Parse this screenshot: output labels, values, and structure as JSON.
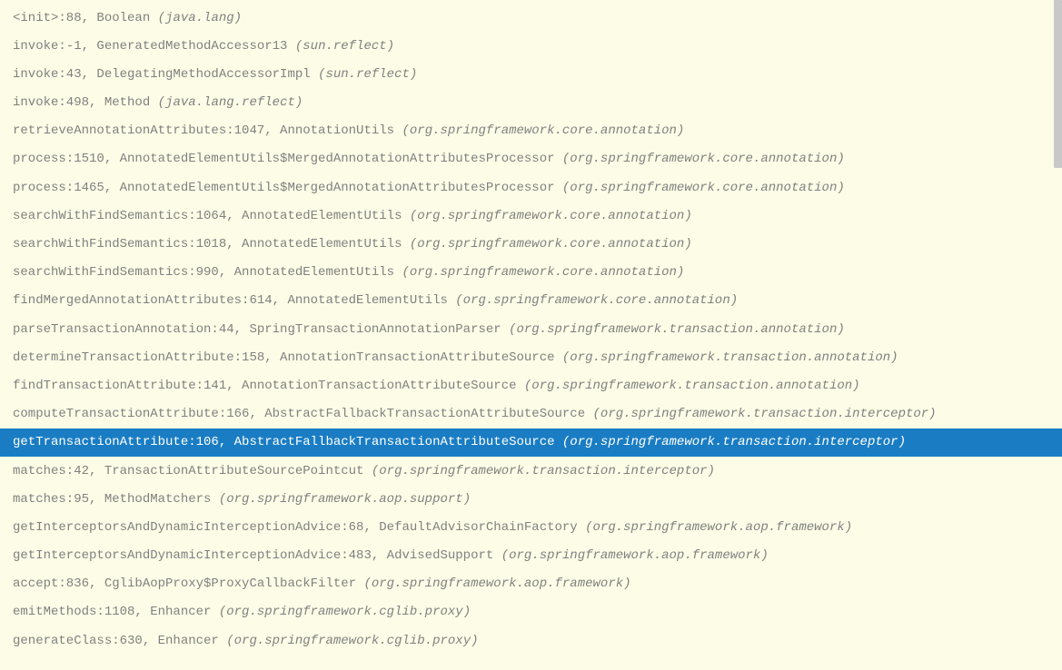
{
  "selectedIndex": 15,
  "frames": [
    {
      "method": "<init>",
      "line": "88",
      "class": "Boolean",
      "package": "(java.lang)"
    },
    {
      "method": "invoke",
      "line": "-1",
      "class": "GeneratedMethodAccessor13",
      "package": "(sun.reflect)"
    },
    {
      "method": "invoke",
      "line": "43",
      "class": "DelegatingMethodAccessorImpl",
      "package": "(sun.reflect)"
    },
    {
      "method": "invoke",
      "line": "498",
      "class": "Method",
      "package": "(java.lang.reflect)"
    },
    {
      "method": "retrieveAnnotationAttributes",
      "line": "1047",
      "class": "AnnotationUtils",
      "package": "(org.springframework.core.annotation)"
    },
    {
      "method": "process",
      "line": "1510",
      "class": "AnnotatedElementUtils$MergedAnnotationAttributesProcessor",
      "package": "(org.springframework.core.annotation)"
    },
    {
      "method": "process",
      "line": "1465",
      "class": "AnnotatedElementUtils$MergedAnnotationAttributesProcessor",
      "package": "(org.springframework.core.annotation)"
    },
    {
      "method": "searchWithFindSemantics",
      "line": "1064",
      "class": "AnnotatedElementUtils",
      "package": "(org.springframework.core.annotation)"
    },
    {
      "method": "searchWithFindSemantics",
      "line": "1018",
      "class": "AnnotatedElementUtils",
      "package": "(org.springframework.core.annotation)"
    },
    {
      "method": "searchWithFindSemantics",
      "line": "990",
      "class": "AnnotatedElementUtils",
      "package": "(org.springframework.core.annotation)"
    },
    {
      "method": "findMergedAnnotationAttributes",
      "line": "614",
      "class": "AnnotatedElementUtils",
      "package": "(org.springframework.core.annotation)"
    },
    {
      "method": "parseTransactionAnnotation",
      "line": "44",
      "class": "SpringTransactionAnnotationParser",
      "package": "(org.springframework.transaction.annotation)"
    },
    {
      "method": "determineTransactionAttribute",
      "line": "158",
      "class": "AnnotationTransactionAttributeSource",
      "package": "(org.springframework.transaction.annotation)"
    },
    {
      "method": "findTransactionAttribute",
      "line": "141",
      "class": "AnnotationTransactionAttributeSource",
      "package": "(org.springframework.transaction.annotation)"
    },
    {
      "method": "computeTransactionAttribute",
      "line": "166",
      "class": "AbstractFallbackTransactionAttributeSource",
      "package": "(org.springframework.transaction.interceptor)"
    },
    {
      "method": "getTransactionAttribute",
      "line": "106",
      "class": "AbstractFallbackTransactionAttributeSource",
      "package": "(org.springframework.transaction.interceptor)"
    },
    {
      "method": "matches",
      "line": "42",
      "class": "TransactionAttributeSourcePointcut",
      "package": "(org.springframework.transaction.interceptor)"
    },
    {
      "method": "matches",
      "line": "95",
      "class": "MethodMatchers",
      "package": "(org.springframework.aop.support)"
    },
    {
      "method": "getInterceptorsAndDynamicInterceptionAdvice",
      "line": "68",
      "class": "DefaultAdvisorChainFactory",
      "package": "(org.springframework.aop.framework)"
    },
    {
      "method": "getInterceptorsAndDynamicInterceptionAdvice",
      "line": "483",
      "class": "AdvisedSupport",
      "package": "(org.springframework.aop.framework)"
    },
    {
      "method": "accept",
      "line": "836",
      "class": "CglibAopProxy$ProxyCallbackFilter",
      "package": "(org.springframework.aop.framework)"
    },
    {
      "method": "emitMethods",
      "line": "1108",
      "class": "Enhancer",
      "package": "(org.springframework.cglib.proxy)"
    },
    {
      "method": "generateClass",
      "line": "630",
      "class": "Enhancer",
      "package": "(org.springframework.cglib.proxy)"
    }
  ]
}
